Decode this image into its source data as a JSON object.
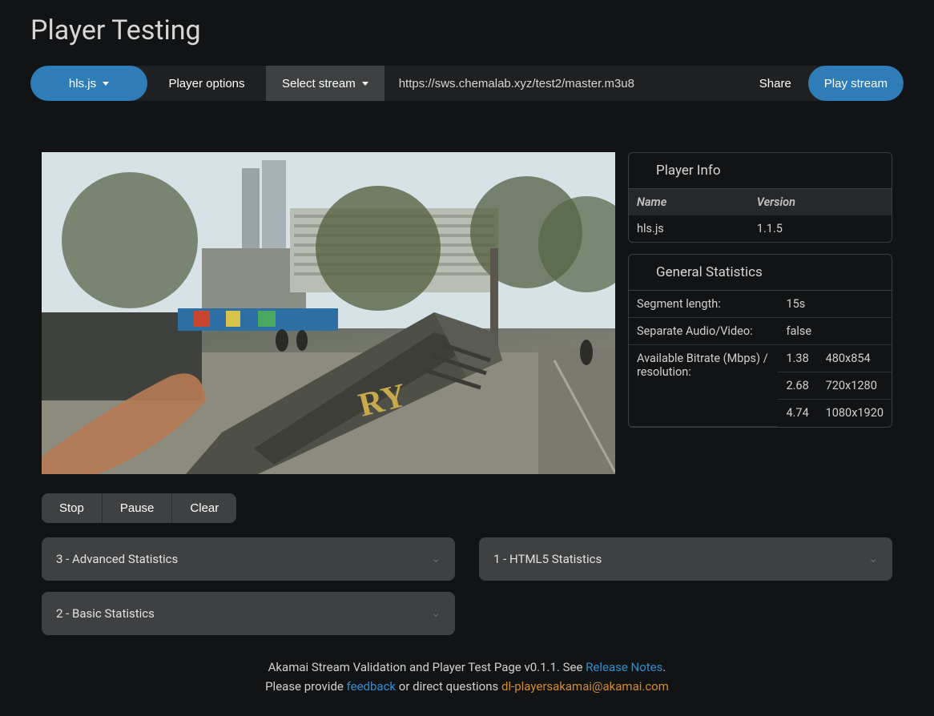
{
  "title": "Player Testing",
  "toolbar": {
    "player_select": "hls.js",
    "options": "Player options",
    "select_stream": "Select stream",
    "url": "https://sws.chemalab.xyz/test2/master.m3u8",
    "share": "Share",
    "play": "Play stream"
  },
  "player_info": {
    "header": "Player Info",
    "name_hdr": "Name",
    "version_hdr": "Version",
    "name": "hls.js",
    "version": "1.1.5"
  },
  "general_stats": {
    "header": "General Statistics",
    "segment_label": "Segment length:",
    "segment_value": "15s",
    "sepav_label": "Separate Audio/Video:",
    "sepav_value": "false",
    "bitrate_label": "Available Bitrate (Mbps) / resolution:",
    "bitrates": [
      {
        "mbps": "1.38",
        "res": "480x854"
      },
      {
        "mbps": "2.68",
        "res": "720x1280"
      },
      {
        "mbps": "4.74",
        "res": "1080x1920"
      }
    ]
  },
  "controls": {
    "stop": "Stop",
    "pause": "Pause",
    "clear": "Clear"
  },
  "accordions": {
    "advanced": "3 - Advanced Statistics",
    "html5": "1 - HTML5 Statistics",
    "basic": "2 - Basic Statistics"
  },
  "footer": {
    "line1_a": "Akamai Stream Validation and Player Test Page v0.1.1. See ",
    "release_notes": "Release Notes",
    "line1_b": ".",
    "line2_a": "Please provide ",
    "feedback": "feedback",
    "line2_b": " or direct questions ",
    "email": "dl-playersakamai@akamai.com"
  }
}
